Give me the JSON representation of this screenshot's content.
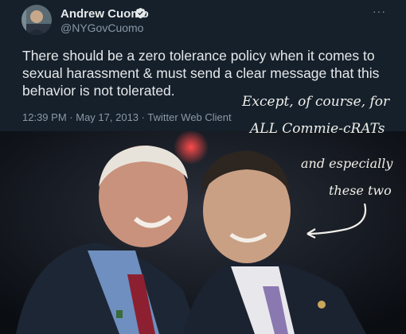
{
  "tweet": {
    "author_name": "Andrew Cuomo",
    "author_handle": "@NYGovCuomo",
    "text_lines": [
      "There should be a zero tolerance policy when it comes to",
      "sexual harassment & must send a clear message that this",
      "behavior is not tolerated."
    ],
    "time": "12:39 PM",
    "date": "May 17, 2013",
    "source": "Twitter Web Client",
    "separator": "·",
    "more_icon": "···",
    "icons": {
      "verified": "verified-badge-icon",
      "more": "more-options-icon"
    },
    "colors": {
      "background": "#15202b",
      "text": "#e7e9ea",
      "muted": "#8b98a5",
      "verified": "#1d9bf0"
    }
  },
  "annotation": {
    "lines": [
      "Except, of course, for",
      "ALL Commie-cRATs",
      "and especially",
      "these two"
    ]
  }
}
